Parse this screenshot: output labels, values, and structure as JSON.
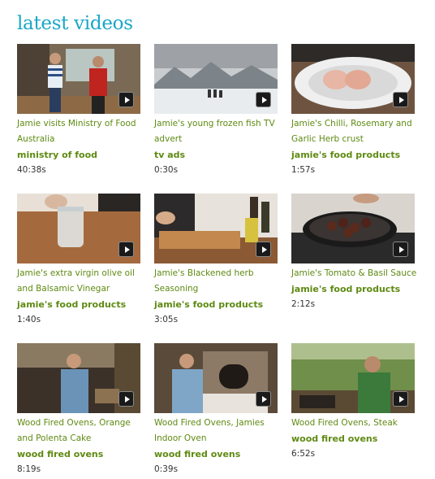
{
  "section": {
    "title": "latest videos"
  },
  "videos": [
    {
      "title": "Jamie visits Ministry of Food Australia",
      "category": "ministry of food",
      "duration": "40:38s"
    },
    {
      "title": "Jamie's young frozen fish TV advert",
      "category": "tv ads",
      "duration": "0:30s"
    },
    {
      "title": "Jamie's Chilli, Rosemary and Garlic Herb crust",
      "category": "jamie's food products",
      "duration": "1:57s"
    },
    {
      "title": "Jamie's extra virgin olive oil and Balsamic Vinegar",
      "category": "jamie's food products",
      "duration": "1:40s"
    },
    {
      "title": "Jamie's Blackened herb Seasoning",
      "category": "jamie's food products",
      "duration": "3:05s"
    },
    {
      "title": "Jamie's Tomato & Basil Sauce",
      "category": "jamie's food products",
      "duration": "2:12s"
    },
    {
      "title": "Wood Fired Ovens, Orange and Polenta Cake",
      "category": "wood fired ovens",
      "duration": "8:19s"
    },
    {
      "title": "Wood Fired Ovens, Jamies Indoor Oven",
      "category": "wood fired ovens",
      "duration": "0:39s"
    },
    {
      "title": "Wood Fired Ovens, Steak",
      "category": "wood fired ovens",
      "duration": "6:52s"
    }
  ],
  "icons": {
    "play": "play-icon"
  },
  "colors": {
    "heading": "#19a7c9",
    "link": "#5e8a12",
    "text": "#333333"
  }
}
